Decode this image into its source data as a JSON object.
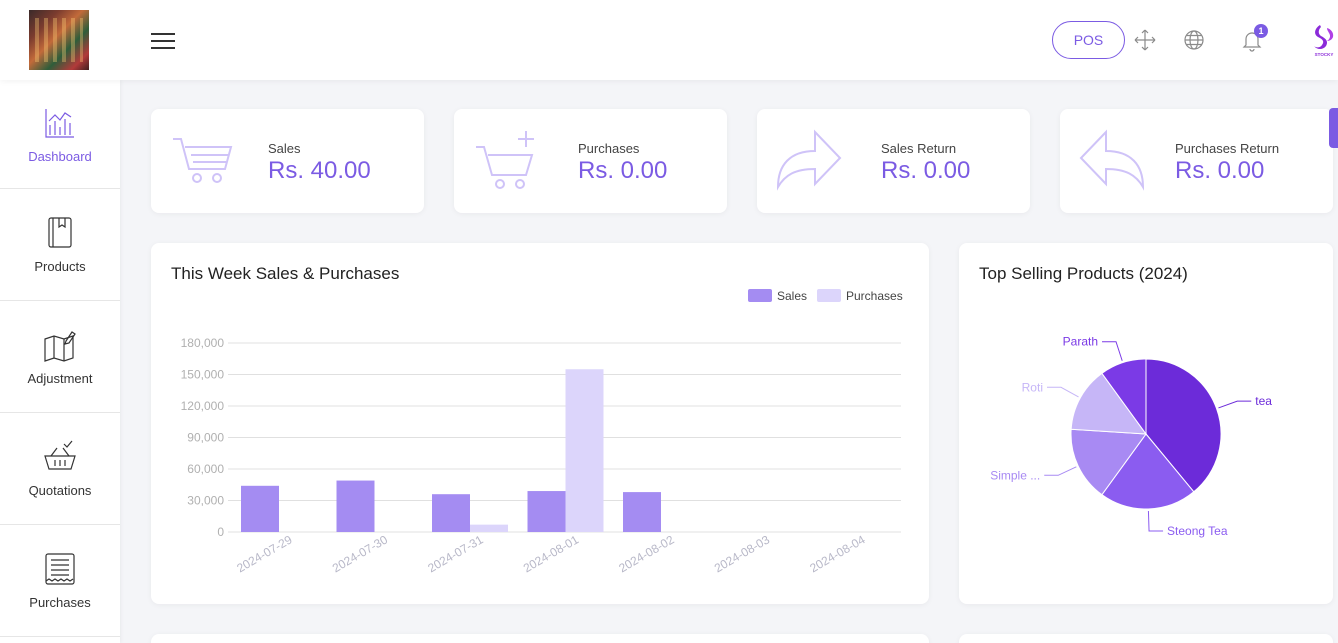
{
  "topbar": {
    "pos_label": "POS",
    "notification_count": "1",
    "brand_text": "STOCKY"
  },
  "sidebar": {
    "items": [
      {
        "label": "Dashboard",
        "icon": "chart-icon",
        "active": true
      },
      {
        "label": "Products",
        "icon": "book-icon"
      },
      {
        "label": "Adjustment",
        "icon": "map-edit-icon"
      },
      {
        "label": "Quotations",
        "icon": "basket-check-icon"
      },
      {
        "label": "Purchases",
        "icon": "receipt-icon"
      }
    ]
  },
  "stats": [
    {
      "label": "Sales",
      "value": "Rs. 40.00",
      "icon": "cart-icon"
    },
    {
      "label": "Purchases",
      "value": "Rs. 0.00",
      "icon": "cart-plus-icon"
    },
    {
      "label": "Sales Return",
      "value": "Rs. 0.00",
      "icon": "forward-arrow-icon"
    },
    {
      "label": "Purchases Return",
      "value": "Rs. 0.00",
      "icon": "back-arrow-icon"
    }
  ],
  "colors": {
    "accent": "#7b5be3",
    "sales": "#a48cf2",
    "purchases": "#dcd5fb"
  },
  "chart_data": [
    {
      "type": "bar",
      "title": "This Week Sales & Purchases",
      "categories": [
        "2024-07-29",
        "2024-07-30",
        "2024-07-31",
        "2024-08-01",
        "2024-08-02",
        "2024-08-03",
        "2024-08-04"
      ],
      "series": [
        {
          "name": "Sales",
          "values": [
            44000,
            49000,
            36000,
            39000,
            38000,
            0,
            0
          ]
        },
        {
          "name": "Purchases",
          "values": [
            0,
            0,
            7000,
            155000,
            0,
            0,
            0
          ]
        }
      ],
      "ylim": [
        0,
        180000
      ],
      "yticks": [
        "0",
        "30,000",
        "60,000",
        "90,000",
        "120,000",
        "150,000",
        "180,000"
      ],
      "grid": true,
      "legend": "top-right"
    },
    {
      "type": "pie",
      "title": "Top Selling Products (2024)",
      "labels": [
        "tea",
        "Steong Tea",
        "Simple ...",
        "Roti",
        "Parath"
      ],
      "values": [
        39,
        21,
        16,
        14,
        10
      ],
      "colors": [
        "#6c2bd9",
        "#8b5cf0",
        "#a88af3",
        "#c6b6f7",
        "#7b3ae6"
      ]
    }
  ]
}
